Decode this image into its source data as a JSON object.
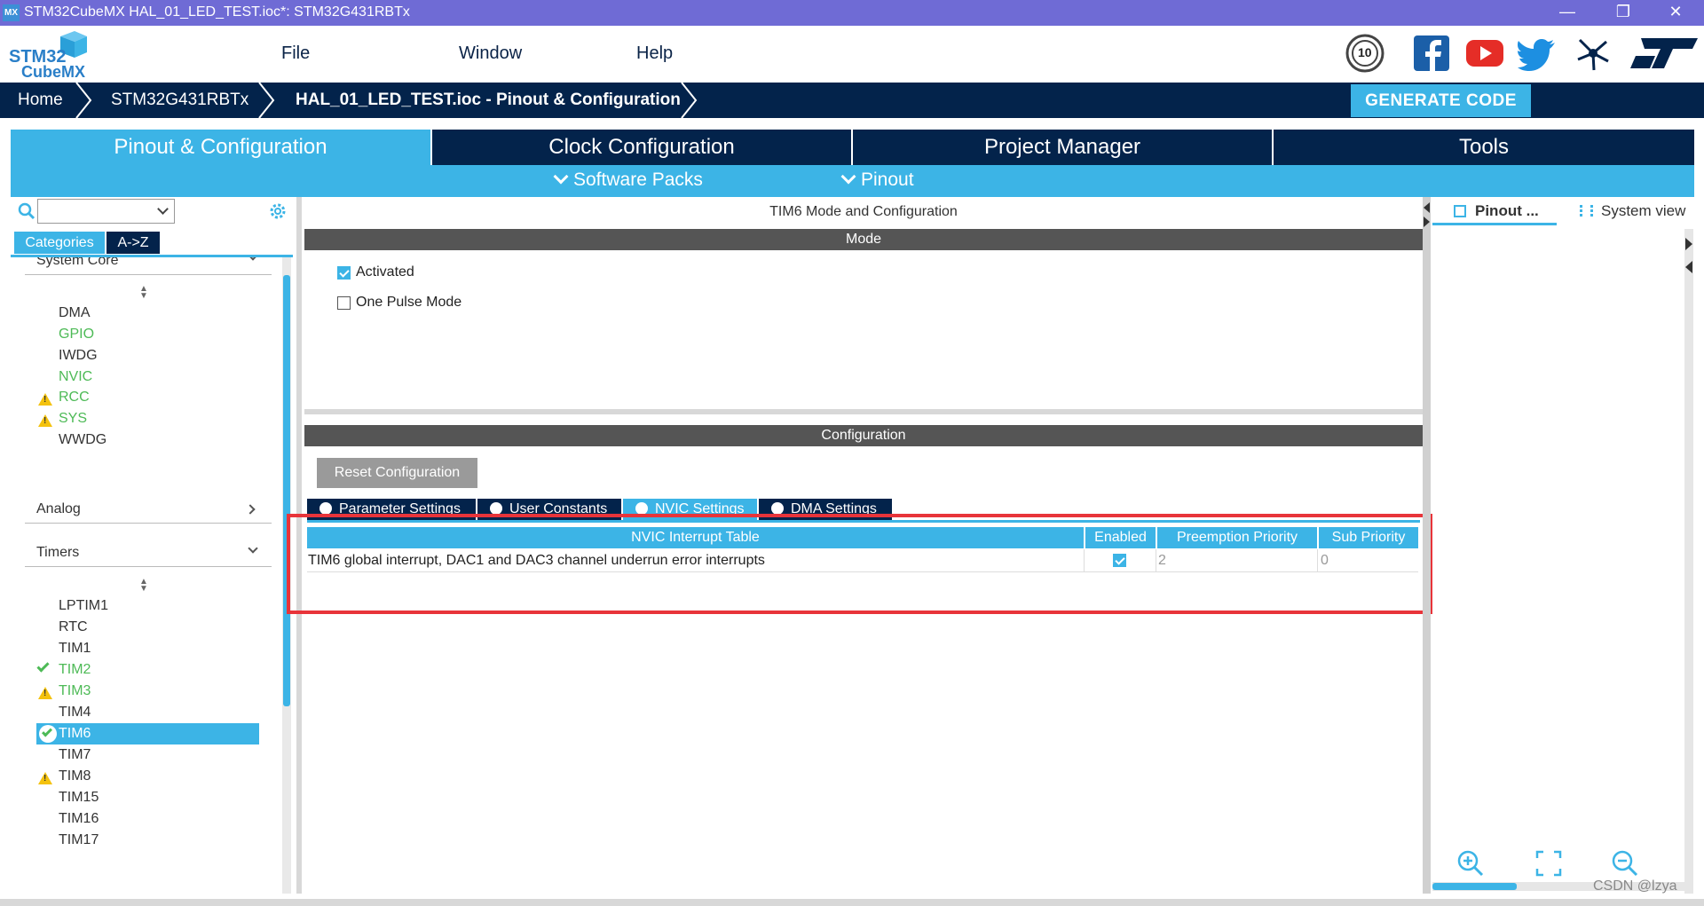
{
  "window": {
    "badge": "MX",
    "title": "STM32CubeMX HAL_01_LED_TEST.ioc*: STM32G431RBTx",
    "controls": [
      "minimize-icon",
      "restore-icon",
      "close-icon"
    ]
  },
  "brand": {
    "line1": "STM32",
    "line2": "CubeMX"
  },
  "menu": {
    "file": "File",
    "window": "Window",
    "help": "Help"
  },
  "social": [
    "anniversary-badge-icon",
    "facebook-icon",
    "youtube-icon",
    "twitter-icon",
    "network-icon",
    "st-logo-icon"
  ],
  "anniversary": "10",
  "breadcrumb": {
    "home": "Home",
    "device": "STM32G431RBTx",
    "project": "HAL_01_LED_TEST.ioc - Pinout & Configuration"
  },
  "generate_label": "GENERATE CODE",
  "tabs": {
    "pinout": "Pinout & Configuration",
    "clock": "Clock Configuration",
    "project": "Project Manager",
    "tools": "Tools"
  },
  "subtabs": {
    "software_packs": "Software Packs",
    "pinout": "Pinout"
  },
  "sidebar": {
    "search_value": "",
    "categories_tab": "Categories",
    "az_tab": "A->Z",
    "system_core": "System Core",
    "system_items": [
      {
        "label": "DMA",
        "status": "none"
      },
      {
        "label": "GPIO",
        "status": "configured"
      },
      {
        "label": "IWDG",
        "status": "none"
      },
      {
        "label": "NVIC",
        "status": "configured"
      },
      {
        "label": "RCC",
        "status": "warning"
      },
      {
        "label": "SYS",
        "status": "warning"
      },
      {
        "label": "WWDG",
        "status": "none"
      }
    ],
    "analog": "Analog",
    "timers": "Timers",
    "timer_items": [
      {
        "label": "LPTIM1",
        "status": "none"
      },
      {
        "label": "RTC",
        "status": "none"
      },
      {
        "label": "TIM1",
        "status": "none"
      },
      {
        "label": "TIM2",
        "status": "ok"
      },
      {
        "label": "TIM3",
        "status": "warning"
      },
      {
        "label": "TIM4",
        "status": "none"
      },
      {
        "label": "TIM6",
        "status": "selected"
      },
      {
        "label": "TIM7",
        "status": "none"
      },
      {
        "label": "TIM8",
        "status": "warning"
      },
      {
        "label": "TIM15",
        "status": "none"
      },
      {
        "label": "TIM16",
        "status": "none"
      },
      {
        "label": "TIM17",
        "status": "none"
      }
    ]
  },
  "center": {
    "title": "TIM6 Mode and Configuration",
    "mode_header": "Mode",
    "activated_label": "Activated",
    "activated_checked": true,
    "one_pulse_label": "One Pulse Mode",
    "one_pulse_checked": false,
    "config_header": "Configuration",
    "reset_label": "Reset Configuration",
    "config_tabs": [
      "Parameter Settings",
      "User Constants",
      "NVIC Settings",
      "DMA Settings"
    ],
    "active_config_tab": "NVIC Settings",
    "nvic_table": {
      "headers": [
        "NVIC Interrupt Table",
        "Enabled",
        "Preemption Priority",
        "Sub Priority"
      ],
      "rows": [
        {
          "name": "TIM6 global interrupt, DAC1 and DAC3 channel underrun error interrupts",
          "enabled": true,
          "preemption": "2",
          "sub": "0"
        }
      ]
    },
    "highlight_color": "#e8343a"
  },
  "right": {
    "pinout_tab": "Pinout ...",
    "system_tab": "System view",
    "zoom_controls": [
      "zoom-in-icon",
      "fit-icon",
      "zoom-out-icon"
    ]
  },
  "watermark": "CSDN @lzya",
  "colors": {
    "accent": "#3cb4e6",
    "navy": "#03234b",
    "green": "#4dba56",
    "warning": "#f4c20d"
  }
}
